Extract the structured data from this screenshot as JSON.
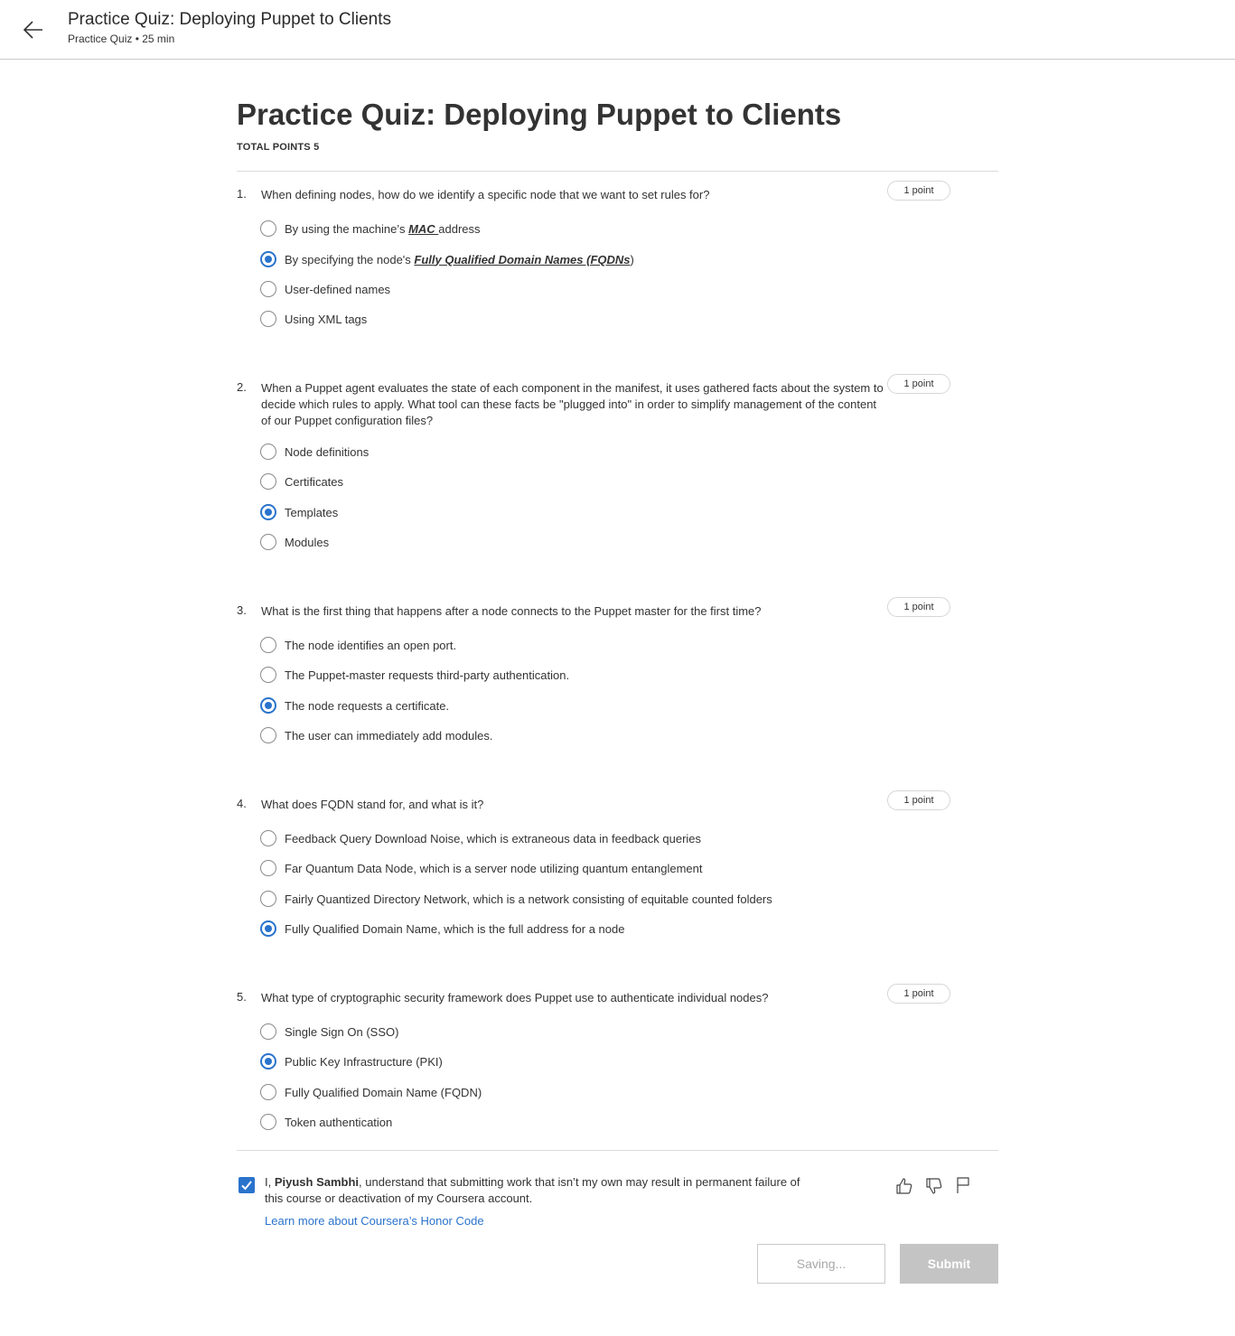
{
  "header": {
    "title": "Practice Quiz: Deploying Puppet to Clients",
    "subtitle": "Practice Quiz • 25 min",
    "back_icon": "arrow-left-icon"
  },
  "quiz": {
    "title": "Practice Quiz: Deploying Puppet to Clients",
    "total_points": "TOTAL POINTS 5"
  },
  "questions": [
    {
      "number": "1.",
      "text": "When defining nodes, how do we identify a specific node that we want to set rules for?",
      "points": "1 point",
      "options": [
        {
          "pre": "By using the machine’s ",
          "emph": "MAC ",
          "post": "address",
          "selected": false
        },
        {
          "pre": "By specifying the node's ",
          "emph": "Fully Qualified Domain Names (FQDNs",
          "post": ")",
          "selected": true
        },
        {
          "pre": "User-defined names",
          "emph": "",
          "post": "",
          "selected": false
        },
        {
          "pre": "Using XML tags",
          "emph": "",
          "post": "",
          "selected": false
        }
      ]
    },
    {
      "number": "2.",
      "text": "When a Puppet agent evaluates the state of each component in the manifest, it uses gathered facts about the system to decide which rules to apply. What tool can these facts be \"plugged into\" in order to simplify management of the content of our Puppet configuration files?",
      "points": "1 point",
      "options": [
        {
          "pre": "Node definitions",
          "emph": "",
          "post": "",
          "selected": false
        },
        {
          "pre": "Certificates",
          "emph": "",
          "post": "",
          "selected": false
        },
        {
          "pre": "Templates",
          "emph": "",
          "post": "",
          "selected": true
        },
        {
          "pre": "Modules",
          "emph": "",
          "post": "",
          "selected": false
        }
      ]
    },
    {
      "number": "3.",
      "text": "What is the first thing that happens after a node connects to the Puppet master for the first time?",
      "points": "1 point",
      "options": [
        {
          "pre": "The node identifies an open port.",
          "emph": "",
          "post": "",
          "selected": false
        },
        {
          "pre": "The Puppet-master requests third-party authentication.",
          "emph": "",
          "post": "",
          "selected": false
        },
        {
          "pre": "The node requests a certificate.",
          "emph": "",
          "post": "",
          "selected": true
        },
        {
          "pre": "The user can immediately add modules.",
          "emph": "",
          "post": "",
          "selected": false
        }
      ]
    },
    {
      "number": "4.",
      "text": "What does FQDN stand for, and what is it?",
      "points": "1 point",
      "options": [
        {
          "pre": "Feedback Query Download Noise, which is extraneous data in feedback queries",
          "emph": "",
          "post": "",
          "selected": false
        },
        {
          "pre": "Far Quantum Data Node, which is a server node utilizing quantum entanglement",
          "emph": "",
          "post": "",
          "selected": false
        },
        {
          "pre": "Fairly Quantized Directory Network, which is a network consisting of equitable counted folders",
          "emph": "",
          "post": "",
          "selected": false
        },
        {
          "pre": "Fully Qualified Domain Name, which is the full address for a node",
          "emph": "",
          "post": "",
          "selected": true
        }
      ]
    },
    {
      "number": "5.",
      "text": "What type of cryptographic security framework does Puppet use to authenticate individual nodes?",
      "points": "1 point",
      "options": [
        {
          "pre": "Single Sign On (SSO)",
          "emph": "",
          "post": "",
          "selected": false
        },
        {
          "pre": "Public Key Infrastructure (PKI)",
          "emph": "",
          "post": "",
          "selected": true
        },
        {
          "pre": "Fully Qualified Domain Name (FQDN)",
          "emph": "",
          "post": "",
          "selected": false
        },
        {
          "pre": "Token authentication",
          "emph": "",
          "post": "",
          "selected": false
        }
      ]
    }
  ],
  "honor_code": {
    "checked": true,
    "prefix": "I, ",
    "name": "Piyush Sambhi",
    "suffix": ", understand that submitting work that isn’t my own may result in permanent failure of this course or deactivation of my Coursera account.",
    "link": "Learn more about Coursera’s Honor Code"
  },
  "feedback_icons": [
    "thumbs-up-icon",
    "thumbs-down-icon",
    "flag-icon"
  ],
  "buttons": {
    "saving": "Saving...",
    "submit": "Submit"
  },
  "colors": {
    "accent": "#2a73cc",
    "submit_disabled": "#c4c4c4"
  }
}
